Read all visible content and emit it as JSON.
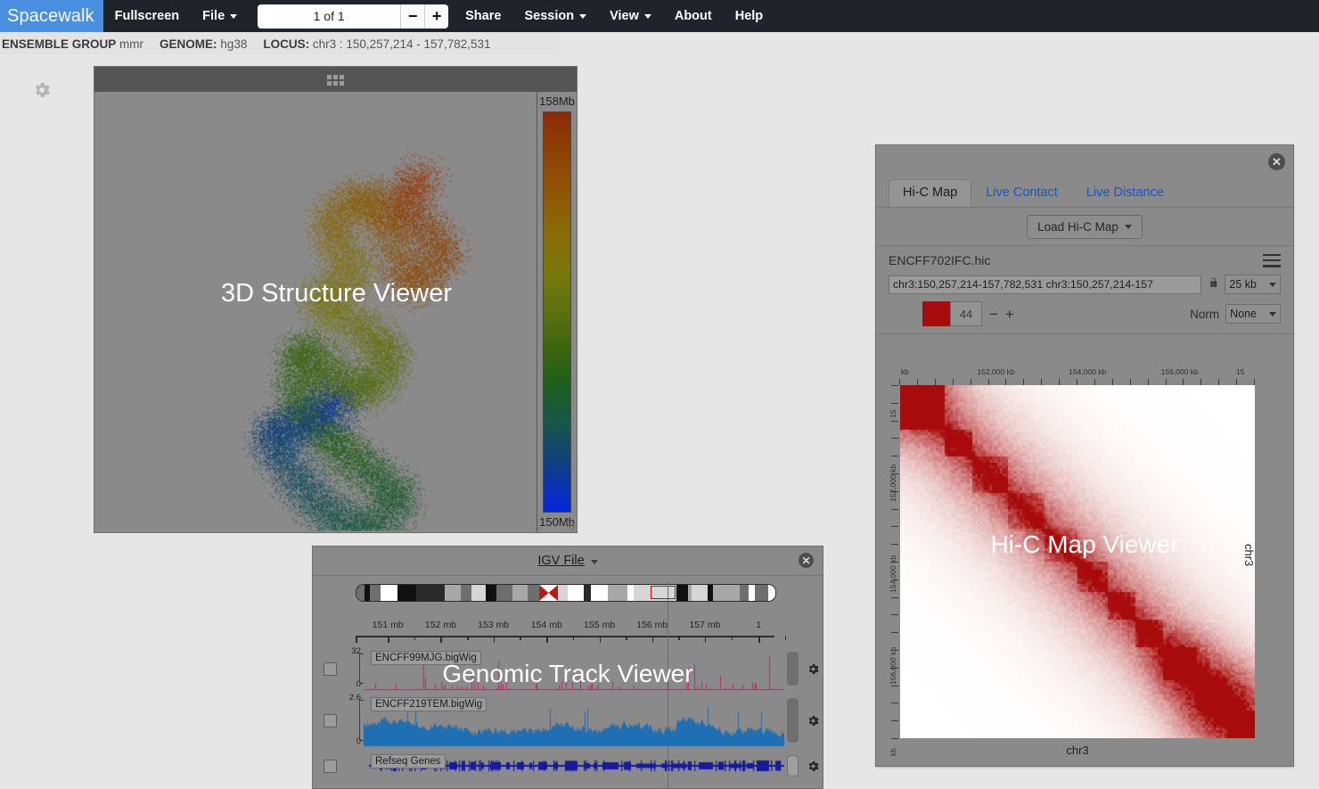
{
  "app": {
    "logo": "Spacewalk",
    "nav_items": [
      {
        "label": "Fullscreen",
        "has_caret": false
      },
      {
        "label": "File",
        "has_caret": true
      }
    ],
    "nav_items_right": [
      {
        "label": "Share",
        "has_caret": false
      },
      {
        "label": "Session",
        "has_caret": true
      },
      {
        "label": "View",
        "has_caret": true
      },
      {
        "label": "About",
        "has_caret": false
      },
      {
        "label": "Help",
        "has_caret": false
      }
    ],
    "pager": {
      "value": "1 of 1",
      "minus": "−",
      "plus": "+"
    }
  },
  "subheader": {
    "ensemble_label": "ENSEMBLE GROUP",
    "ensemble_value": "mmr",
    "genome_label": "GENOME:",
    "genome_value": "hg38",
    "locus_label": "LOCUS:",
    "locus_value": "chr3 : 150,257,214 - 157,782,531"
  },
  "viewer3d": {
    "overlay_label": "3D Structure Viewer",
    "colorbar_top": "158Mb",
    "colorbar_bottom": "150Mb"
  },
  "hic": {
    "overlay_label": "Hi-C Map Viewer",
    "tabs": [
      {
        "label": "Hi-C Map",
        "active": true
      },
      {
        "label": "Live Contact",
        "active": false
      },
      {
        "label": "Live Distance",
        "active": false
      }
    ],
    "load_button": "Load Hi-C Map",
    "filename": "ENCFF702IFC.hic",
    "locus_value": "chr3:150,257,214-157,782,531 chr3:150,257,214-157",
    "resolution": "25 kb",
    "threshold": "44",
    "threshold_minus": "−",
    "threshold_plus": "+",
    "norm_label": "Norm",
    "norm_value": "None",
    "swatch_color": "#a70b0b",
    "chr_bottom": "chr3",
    "chr_right": "chr3",
    "x_ticks": [
      {
        "label": "kb",
        "pos": 0.04
      },
      {
        "label": "152,000 kb",
        "pos": 0.255
      },
      {
        "label": "154,000 kb",
        "pos": 0.513
      },
      {
        "label": "156,000 kb",
        "pos": 0.773
      },
      {
        "label": "15",
        "pos": 0.985
      }
    ],
    "y_ticks": [
      {
        "label": "15",
        "pos": 0.018
      },
      {
        "label": "152,000 kb",
        "pos": 0.255
      },
      {
        "label": "154,000 kb",
        "pos": 0.513
      },
      {
        "label": "156,000 kb",
        "pos": 0.773
      },
      {
        "label": "kb",
        "pos": 0.975
      }
    ]
  },
  "igv": {
    "overlay_label": "Genomic Track Viewer",
    "title": "IGV File",
    "ruler_ticks": [
      {
        "label": "151 mb",
        "pos": 0.077
      },
      {
        "label": "152 mb",
        "pos": 0.203
      },
      {
        "label": "153 mb",
        "pos": 0.329
      },
      {
        "label": "154 mb",
        "pos": 0.456
      },
      {
        "label": "155 mb",
        "pos": 0.582
      },
      {
        "label": "156 mb",
        "pos": 0.708
      },
      {
        "label": "157 mb",
        "pos": 0.834
      },
      {
        "label": "1",
        "pos": 0.962
      }
    ],
    "tracks": [
      {
        "name": "ENCFF99MJG.bigWig",
        "scale_max": "32",
        "scale_min": "0",
        "color": "#c2256b",
        "type": "wig"
      },
      {
        "name": "ENCFF219TEM.bigWig",
        "scale_max": "2.6",
        "scale_min": "0",
        "color": "#1f6fb4",
        "type": "wig"
      },
      {
        "name": "Refseq Genes",
        "scale_max": "",
        "scale_min": "",
        "color": "#151a9e",
        "type": "annotation"
      }
    ]
  },
  "icons": {
    "settings_gear": "gear-icon",
    "close": "✕",
    "hamburger": "hamburger-icon",
    "lock": "🔓"
  }
}
